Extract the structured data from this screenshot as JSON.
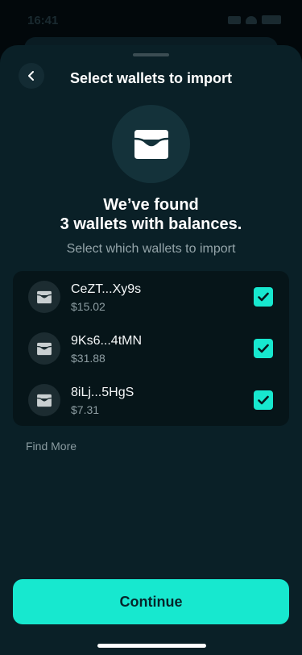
{
  "status_bar": {
    "time": "16:41"
  },
  "header": {
    "title": "Select wallets to import",
    "back_icon": "chevron-left-icon"
  },
  "hero": {
    "icon": "wallet-icon",
    "headline_line1": "We’ve found",
    "headline_line2": "3 wallets with balances.",
    "subtitle": "Select which wallets to import"
  },
  "wallets": [
    {
      "address": "CeZT...Xy9s",
      "balance": "$15.02",
      "selected": true
    },
    {
      "address": "9Ks6...4tMN",
      "balance": "$31.88",
      "selected": true
    },
    {
      "address": "8iLj...5HgS",
      "balance": "$7.31",
      "selected": true
    }
  ],
  "find_more": "Find More",
  "continue_label": "Continue",
  "colors": {
    "accent": "#17e8cf",
    "sheet_background": "#0a2027",
    "list_background": "#061519",
    "muted_text": "#94a4a9"
  }
}
